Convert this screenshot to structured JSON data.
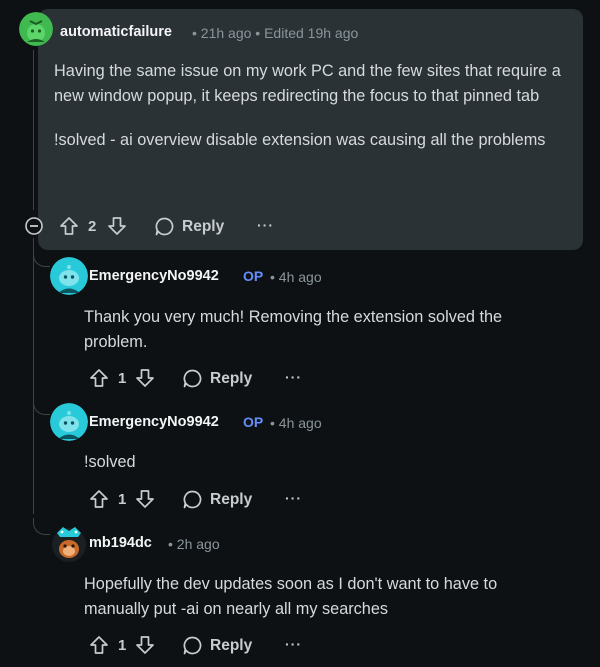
{
  "comments": [
    {
      "username": "automaticfailure",
      "meta": "• 21h ago • Edited 19h ago",
      "paragraphs": [
        "Having the same issue on my work PC and the few sites that require a new window popup, it keeps redirecting the focus to that pinned tab",
        "!solved - ai overview disable extension was causing all the problems"
      ],
      "votes": "2",
      "reply_label": "Reply",
      "more": "···"
    },
    {
      "username": "EmergencyNo9942",
      "op": "OP",
      "meta": "• 4h ago",
      "paragraphs": [
        "Thank you very much! Removing the extension solved the problem."
      ],
      "votes": "1",
      "reply_label": "Reply",
      "more": "···"
    },
    {
      "username": "EmergencyNo9942",
      "op": "OP",
      "meta": "• 4h ago",
      "paragraphs": [
        "!solved"
      ],
      "votes": "1",
      "reply_label": "Reply",
      "more": "···"
    },
    {
      "username": "mb194dc",
      "meta": "• 2h ago",
      "paragraphs": [
        "Hopefully the dev updates soon as I don't want to have to manually put -ai on nearly all my searches"
      ],
      "votes": "1",
      "reply_label": "Reply",
      "more": "···"
    }
  ],
  "colors": {
    "background": "#0e1113",
    "highlight_card": "#2a3236",
    "op_badge": "#648efc",
    "avatar_green": "#3fb950",
    "avatar_teal": "#28c9d8"
  }
}
